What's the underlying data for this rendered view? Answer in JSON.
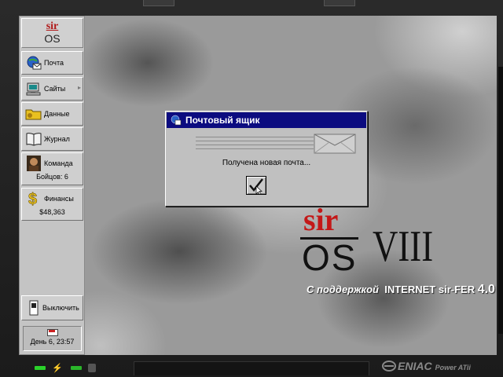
{
  "sidebar": {
    "logo_top": "sir",
    "logo_bottom": "OS",
    "items": [
      {
        "label": "Почта",
        "icon": "globe-mail-icon"
      },
      {
        "label": "Сайты",
        "icon": "computer-icon"
      },
      {
        "label": "Данные",
        "icon": "folder-icon"
      },
      {
        "label": "Журнал",
        "icon": "book-icon"
      },
      {
        "label": "Команда",
        "sub": "Бойцов: 6",
        "icon": "team-portrait-icon"
      },
      {
        "label": "Финансы",
        "sub": "$48,363",
        "icon": "dollar-icon"
      }
    ],
    "power_label": "Выключить",
    "clock": "День 6, 23:57"
  },
  "dialog": {
    "title": "Почтовый ящик",
    "message": "Получена новая почта..."
  },
  "brand": {
    "sir": "sir",
    "os": "OS",
    "version": "VIII",
    "tagline_prefix": "С поддержкой",
    "tagline_main": "INTERNET sir-FER",
    "tagline_version": "4.0"
  },
  "hardware": {
    "maker": "ENIAC",
    "model": "Power ATii"
  },
  "colors": {
    "title_bar": "#0c0c80",
    "brand_red": "#c41818",
    "led_green": "#2ad22a"
  }
}
